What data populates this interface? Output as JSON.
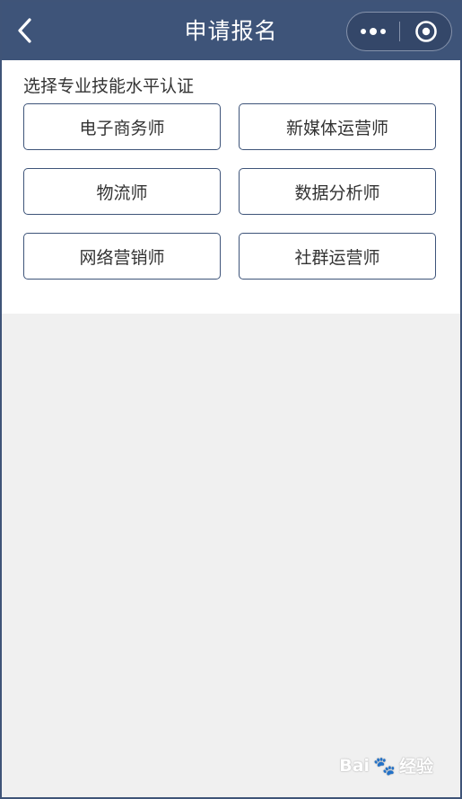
{
  "header": {
    "title": "申请报名",
    "back_icon": "chevron-left-icon",
    "more_icon": "more-dots-icon",
    "close_icon": "target-circle-icon",
    "bg_color": "#3e5479"
  },
  "main": {
    "section_label": "选择专业技能水平认证",
    "options": [
      {
        "label": "电子商务师"
      },
      {
        "label": "新媒体运营师"
      },
      {
        "label": "物流师"
      },
      {
        "label": "数据分析师"
      },
      {
        "label": "网络营销师"
      },
      {
        "label": "社群运营师"
      }
    ],
    "border_color": "#3e5479"
  },
  "watermark": {
    "text": "Bai",
    "text2": "经验",
    "icon": "baidu-paw-icon"
  }
}
